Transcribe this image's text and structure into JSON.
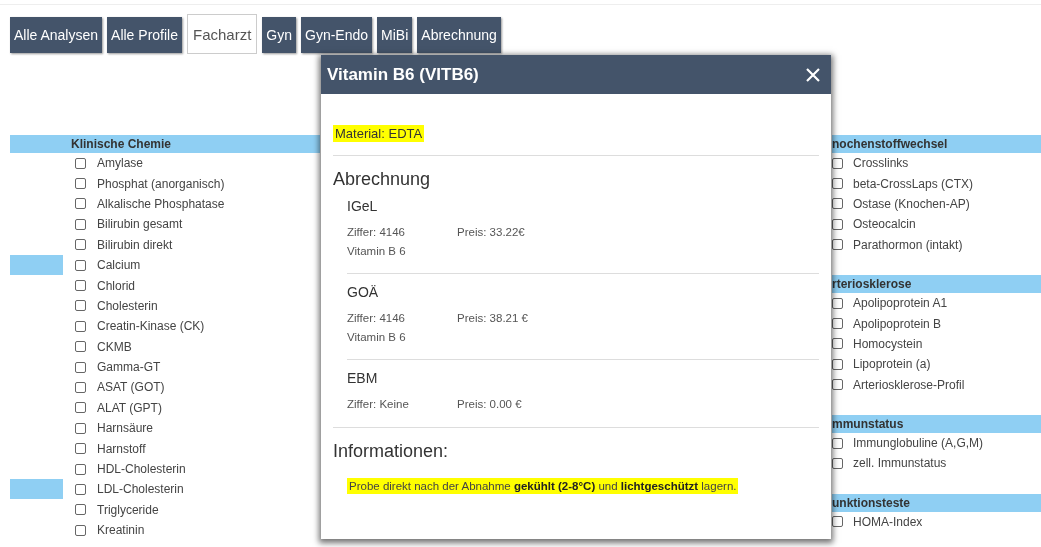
{
  "tabs": [
    {
      "label": "Alle Analysen",
      "selected": false
    },
    {
      "label": "Alle Profile",
      "selected": false
    },
    {
      "label": "Facharzt",
      "selected": true
    },
    {
      "label": "Gyn",
      "selected": false
    },
    {
      "label": "Gyn-Endo",
      "selected": false
    },
    {
      "label": "MiBi",
      "selected": false
    },
    {
      "label": "Abrechnung",
      "selected": false
    }
  ],
  "left_panel": {
    "title": "Klinische Chemie",
    "items": [
      {
        "label": "Amylase",
        "checked": false,
        "highlighted": false
      },
      {
        "label": "Phosphat (anorganisch)",
        "checked": false,
        "highlighted": false
      },
      {
        "label": "Alkalische Phosphatase",
        "checked": false,
        "highlighted": false
      },
      {
        "label": "Bilirubin gesamt",
        "checked": false,
        "highlighted": false
      },
      {
        "label": "Bilirubin direkt",
        "checked": false,
        "highlighted": false
      },
      {
        "label": "Calcium",
        "checked": false,
        "highlighted": true
      },
      {
        "label": "Chlorid",
        "checked": false,
        "highlighted": false
      },
      {
        "label": "Cholesterin",
        "checked": false,
        "highlighted": false
      },
      {
        "label": "Creatin-Kinase (CK)",
        "checked": false,
        "highlighted": false
      },
      {
        "label": "CKMB",
        "checked": false,
        "highlighted": false
      },
      {
        "label": "Gamma-GT",
        "checked": false,
        "highlighted": false
      },
      {
        "label": "ASAT (GOT)",
        "checked": false,
        "highlighted": false
      },
      {
        "label": "ALAT (GPT)",
        "checked": false,
        "highlighted": false
      },
      {
        "label": "Harnsäure",
        "checked": false,
        "highlighted": false
      },
      {
        "label": "Harnstoff",
        "checked": false,
        "highlighted": false
      },
      {
        "label": "HDL-Cholesterin",
        "checked": false,
        "highlighted": false
      },
      {
        "label": "LDL-Cholesterin",
        "checked": false,
        "highlighted": true
      },
      {
        "label": "Triglyceride",
        "checked": false,
        "highlighted": false
      },
      {
        "label": "Kreatinin",
        "checked": false,
        "highlighted": false
      }
    ]
  },
  "right_panel": {
    "groups": [
      {
        "title": "nochenstoffwechsel",
        "items": [
          {
            "label": "Crosslinks",
            "checked": false
          },
          {
            "label": "beta-CrossLaps (CTX)",
            "checked": false
          },
          {
            "label": "Ostase (Knochen-AP)",
            "checked": false
          },
          {
            "label": "Osteocalcin",
            "checked": false
          },
          {
            "label": "Parathormon (intakt)",
            "checked": false
          }
        ]
      },
      {
        "title": "rteriosklerose",
        "items": [
          {
            "label": "Apolipoprotein A1",
            "checked": false
          },
          {
            "label": "Apolipoprotein B",
            "checked": false
          },
          {
            "label": "Homocystein",
            "checked": false
          },
          {
            "label": "Lipoprotein (a)",
            "checked": false
          },
          {
            "label": "Arteriosklerose-Profil",
            "checked": false
          }
        ]
      },
      {
        "title": "mmunstatus",
        "items": [
          {
            "label": "Immunglobuline (A,G,M)",
            "checked": false
          },
          {
            "label": "zell. Immunstatus",
            "checked": false
          }
        ]
      },
      {
        "title": "unktionsteste",
        "items": [
          {
            "label": "HOMA-Index",
            "checked": false
          }
        ]
      }
    ]
  },
  "dialog": {
    "title": "Vitamin B6 (VITB6)",
    "material": "Material: EDTA",
    "billing_heading": "Abrechnung",
    "billing": [
      {
        "name": "IGeL",
        "code": "Ziffer: 4146",
        "price": "Preis: 33.22€",
        "description": "Vitamin B 6"
      },
      {
        "name": "GOÄ",
        "code": "Ziffer: 4146",
        "price": "Preis: 38.21 €",
        "description": "Vitamin B 6"
      },
      {
        "name": "EBM",
        "code": "Ziffer: Keine",
        "price": "Preis: 0.00 €"
      }
    ],
    "info_heading": "Informationen:",
    "info_text": "Probe direkt nach der Abnahme **gekühlt (2-8°C)** und **lichtgeschützt** lagern."
  }
}
